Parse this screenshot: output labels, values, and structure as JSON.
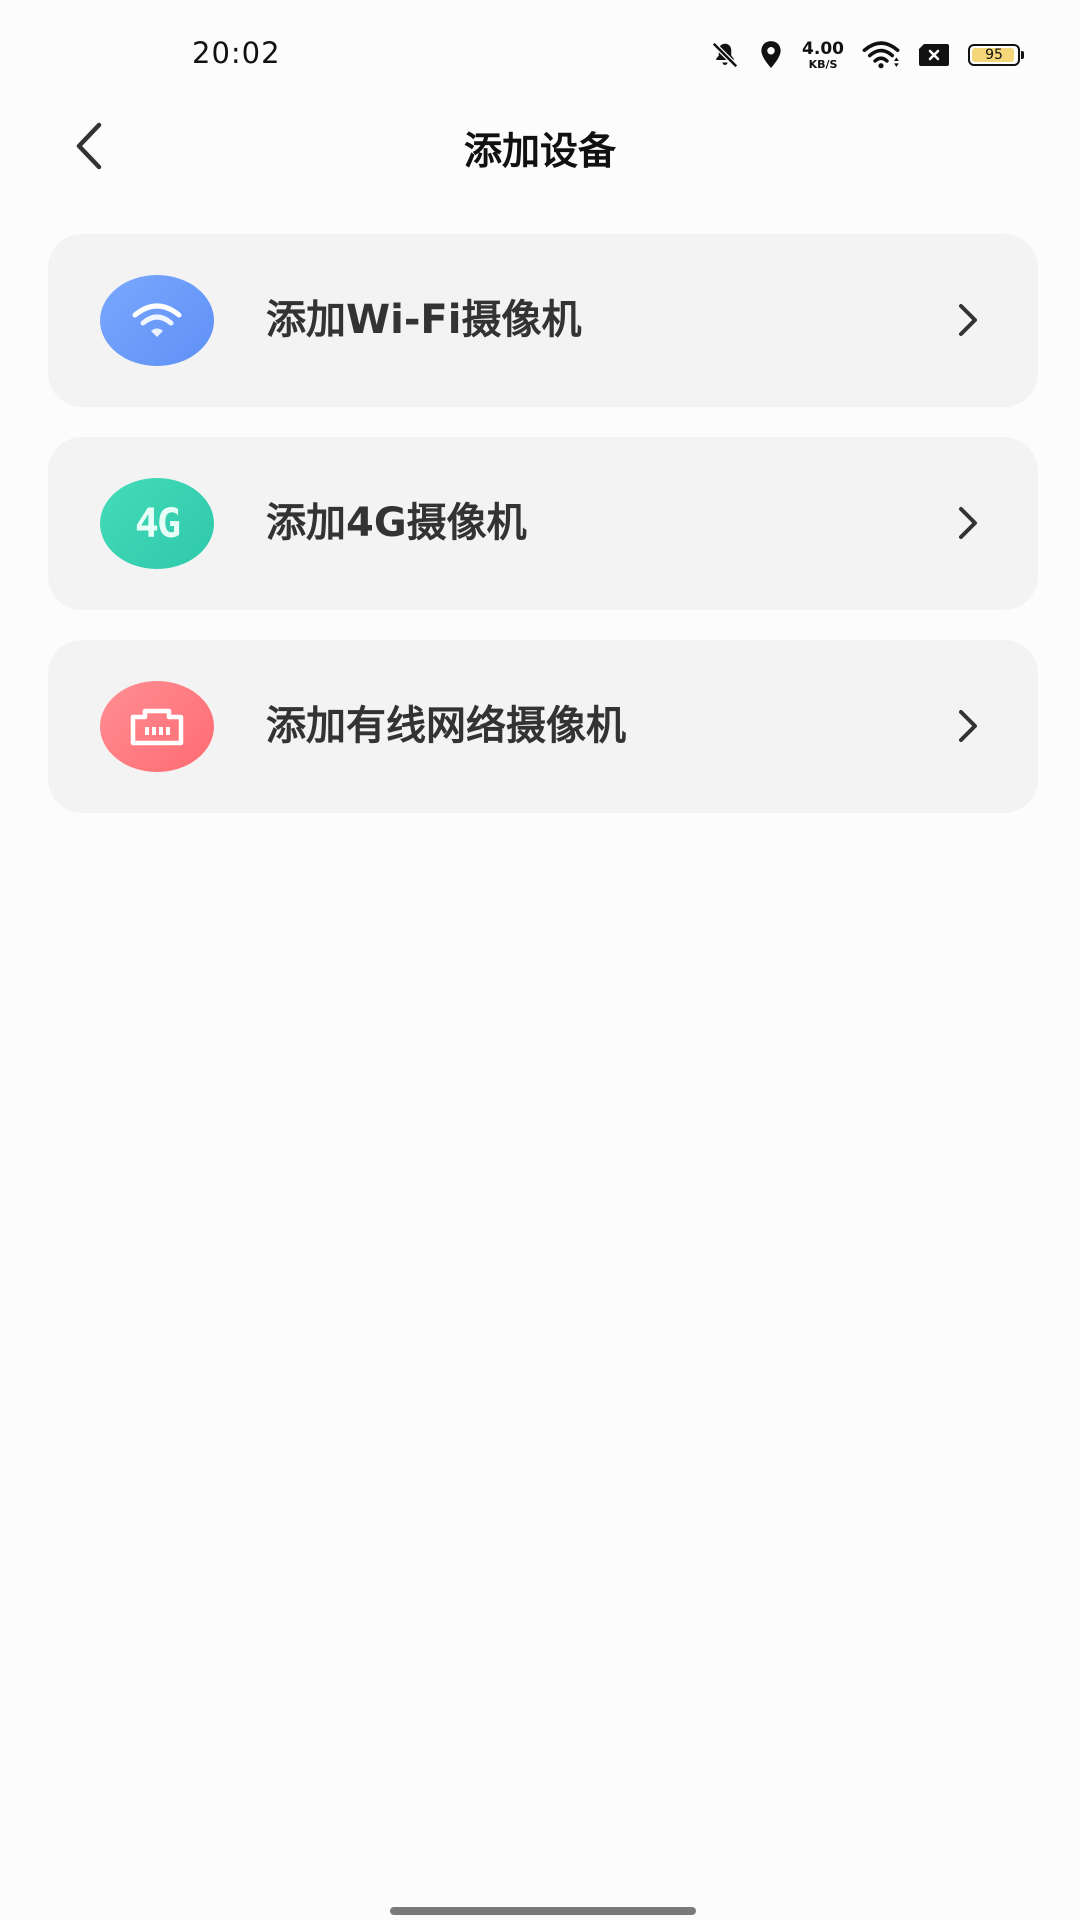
{
  "status_bar": {
    "time": "20:02",
    "net_speed_value": "4.00",
    "net_speed_unit": "KB/S",
    "battery_level": "95",
    "battery_fraction": 0.95,
    "icons": [
      "mute-bell-icon",
      "location-icon",
      "wifi-icon",
      "sim-x-icon",
      "battery-icon"
    ]
  },
  "header": {
    "title": "添加设备",
    "back_icon": "chevron-left-icon"
  },
  "options": [
    {
      "label": "添加Wi-Fi摄像机",
      "icon": "wifi-icon",
      "icon_color": "#6b9cf8"
    },
    {
      "label": "添加4G摄像机",
      "icon": "4g-icon",
      "icon_text": "4G",
      "icon_color": "#3ad0b0"
    },
    {
      "label": "添加有线网络摄像机",
      "icon": "ethernet-port-icon",
      "icon_color": "#ff7b80"
    }
  ]
}
